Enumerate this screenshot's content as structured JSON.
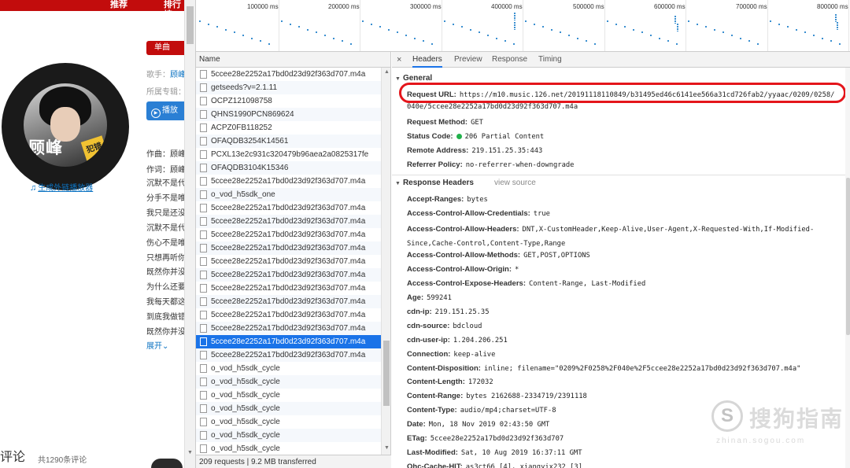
{
  "webpage": {
    "nav": {
      "recommend": "推荐",
      "ranking": "排行榜"
    },
    "cover": {
      "name_text": "顾峰",
      "tag_text": "犯错"
    },
    "external_player_link": "生成外链播放器",
    "single_badge": "单曲",
    "singer_label": "歌手：",
    "singer_value": "顾峰",
    "album_label": "所属专辑：",
    "play_button": "播放",
    "composer": "作曲：顾峰",
    "lyricist": "作词：顾峰",
    "lyrics": [
      "沉默不是代",
      "分手不是唯",
      "我只是还没",
      "沉默不是代",
      "伤心不是唯",
      "只想再听你",
      "既然你并没",
      "为什么还要",
      "我每天都这",
      "到底我做错",
      "既然你并没"
    ],
    "expand": "展开",
    "comments_title": "评论",
    "comments_count": "共1290条评论"
  },
  "timeline": {
    "ticks": [
      "100000 ms",
      "200000 ms",
      "300000 ms",
      "400000 ms",
      "500000 ms",
      "600000 ms",
      "700000 ms",
      "800000 ms"
    ]
  },
  "requests": {
    "column_header": "Name",
    "selected_index": 20,
    "items": [
      "5ccee28e2252a17bd0d23d92f363d707.m4a",
      "getseeds?v=2.1.11",
      "OCPZ121098758",
      "QHNS1990PCN869624",
      "ACPZ0FB118252",
      "OFAQDB3254K14561",
      "PCXL13e2c931c320479b96aea2a0825317fe",
      "OFAQDB3104K15346",
      "5ccee28e2252a17bd0d23d92f363d707.m4a",
      "o_vod_h5sdk_one",
      "5ccee28e2252a17bd0d23d92f363d707.m4a",
      "5ccee28e2252a17bd0d23d92f363d707.m4a",
      "5ccee28e2252a17bd0d23d92f363d707.m4a",
      "5ccee28e2252a17bd0d23d92f363d707.m4a",
      "5ccee28e2252a17bd0d23d92f363d707.m4a",
      "5ccee28e2252a17bd0d23d92f363d707.m4a",
      "5ccee28e2252a17bd0d23d92f363d707.m4a",
      "5ccee28e2252a17bd0d23d92f363d707.m4a",
      "5ccee28e2252a17bd0d23d92f363d707.m4a",
      "5ccee28e2252a17bd0d23d92f363d707.m4a",
      "5ccee28e2252a17bd0d23d92f363d707.m4a",
      "5ccee28e2252a17bd0d23d92f363d707.m4a",
      "o_vod_h5sdk_cycle",
      "o_vod_h5sdk_cycle",
      "o_vod_h5sdk_cycle",
      "o_vod_h5sdk_cycle",
      "o_vod_h5sdk_cycle",
      "o_vod_h5sdk_cycle",
      "o_vod_h5sdk_cycle"
    ],
    "status": "209 requests | 9.2 MB transferred"
  },
  "details": {
    "tabs": [
      "Headers",
      "Preview",
      "Response",
      "Timing"
    ],
    "active_tab": "Headers",
    "close_glyph": "×",
    "general": {
      "title": "General",
      "request_url_label": "Request URL:",
      "request_url_value": "https://m10.music.126.net/20191118110849/b31495ed46c6141ee566a31cd726fab2/yyaac/0209/0258/",
      "request_url_cont": "040e/5ccee28e2252a17bd0d23d92f363d707.m4a",
      "rows": [
        {
          "k": "Request Method:",
          "v": "GET"
        },
        {
          "k": "Status Code:",
          "v": "206 Partial Content"
        },
        {
          "k": "Remote Address:",
          "v": "219.151.25.35:443"
        },
        {
          "k": "Referrer Policy:",
          "v": "no-referrer-when-downgrade"
        }
      ]
    },
    "response": {
      "title": "Response Headers",
      "view_source": "view source",
      "rows": [
        {
          "k": "Accept-Ranges:",
          "v": "bytes"
        },
        {
          "k": "Access-Control-Allow-Credentials:",
          "v": "true"
        },
        {
          "k": "Access-Control-Allow-Headers:",
          "v": "DNT,X-CustomHeader,Keep-Alive,User-Agent,X-Requested-With,If-Modified-Since,Cache-Control,Content-Type,Range"
        },
        {
          "k": "Access-Control-Allow-Methods:",
          "v": "GET,POST,OPTIONS"
        },
        {
          "k": "Access-Control-Allow-Origin:",
          "v": "*"
        },
        {
          "k": "Access-Control-Expose-Headers:",
          "v": "Content-Range, Last-Modified"
        },
        {
          "k": "Age:",
          "v": "599241"
        },
        {
          "k": "cdn-ip:",
          "v": "219.151.25.35"
        },
        {
          "k": "cdn-source:",
          "v": "bdcloud"
        },
        {
          "k": "cdn-user-ip:",
          "v": "1.204.206.251"
        },
        {
          "k": "Connection:",
          "v": "keep-alive"
        },
        {
          "k": "Content-Disposition:",
          "v": "inline; filename=\"0209%2F0258%2F040e%2F5ccee28e2252a17bd0d23d92f363d707.m4a\""
        },
        {
          "k": "Content-Length:",
          "v": "172032"
        },
        {
          "k": "Content-Range:",
          "v": "bytes 2162688-2334719/2391118"
        },
        {
          "k": "Content-Type:",
          "v": "audio/mp4;charset=UTF-8"
        },
        {
          "k": "Date:",
          "v": "Mon, 18 Nov 2019 02:43:50 GMT"
        },
        {
          "k": "ETag:",
          "v": "5ccee28e2252a17bd0d23d92f363d707"
        },
        {
          "k": "Last-Modified:",
          "v": "Sat, 10 Aug 2019 16:37:11 GMT"
        },
        {
          "k": "Ohc-Cache-HIT:",
          "v": "as3ct66 [4], xiangyix232 [3]"
        }
      ]
    }
  },
  "watermark": {
    "logo": "S",
    "text": "搜狗指南",
    "sub": "zhinan.sogou.com"
  },
  "colors": {
    "accent_red": "#c20c0c",
    "link_blue": "#0c73c2",
    "selected_row": "#1a73e8",
    "highlight_circle": "#e4151b",
    "status_green": "#22b14c"
  }
}
